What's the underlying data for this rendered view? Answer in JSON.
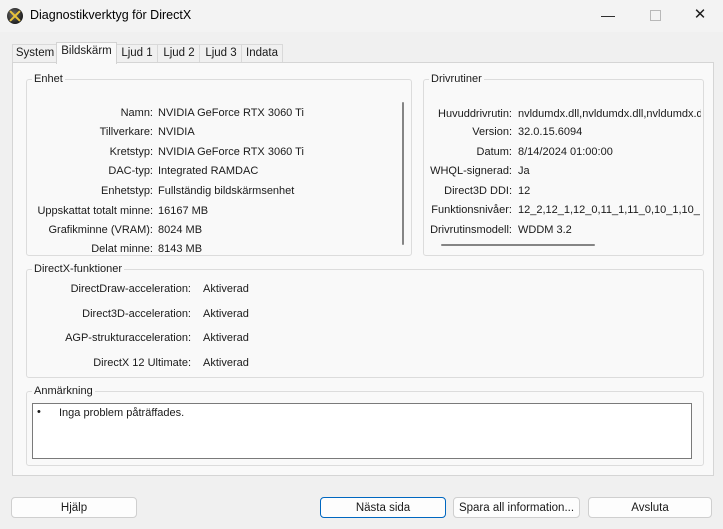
{
  "window": {
    "title": "Diagnostikverktyg för DirectX",
    "minimize_glyph": "—",
    "close_glyph": "✕"
  },
  "tabs": [
    "System",
    "Bildskärm",
    "Ljud 1",
    "Ljud 2",
    "Ljud 3",
    "Indata"
  ],
  "device": {
    "legend": "Enhet",
    "rows": [
      {
        "label": "Namn:",
        "value": "NVIDIA GeForce RTX 3060 Ti"
      },
      {
        "label": "Tillverkare:",
        "value": "NVIDIA"
      },
      {
        "label": "Kretstyp:",
        "value": "NVIDIA GeForce RTX 3060 Ti"
      },
      {
        "label": "DAC-typ:",
        "value": "Integrated RAMDAC"
      },
      {
        "label": "Enhetstyp:",
        "value": "Fullständig bildskärmsenhet"
      },
      {
        "label": "Uppskattat totalt minne:",
        "value": "16167 MB"
      },
      {
        "label": "Grafikminne (VRAM):",
        "value": "8024 MB"
      },
      {
        "label": "Delat minne:",
        "value": "8143 MB"
      }
    ]
  },
  "drivers": {
    "legend": "Drivrutiner",
    "rows": [
      {
        "label": "Huvuddrivrutin:",
        "value": "nvldumdx.dll,nvldumdx.dll,nvldumdx.d"
      },
      {
        "label": "Version:",
        "value": "32.0.15.6094"
      },
      {
        "label": "Datum:",
        "value": "8/14/2024 01:00:00"
      },
      {
        "label": "WHQL-signerad:",
        "value": "Ja"
      },
      {
        "label": "Direct3D DDI:",
        "value": "12"
      },
      {
        "label": "Funktionsnivåer:",
        "value": "12_2,12_1,12_0,11_1,11_0,10_1,10_"
      },
      {
        "label": "Drivrutinsmodell:",
        "value": "WDDM 3.2"
      }
    ]
  },
  "features": {
    "legend": "DirectX-funktioner",
    "rows": [
      {
        "label": "DirectDraw-acceleration:",
        "value": "Aktiverad"
      },
      {
        "label": "Direct3D-acceleration:",
        "value": "Aktiverad"
      },
      {
        "label": "AGP-strukturacceleration:",
        "value": "Aktiverad"
      },
      {
        "label": "DirectX 12 Ultimate:",
        "value": "Aktiverad"
      }
    ]
  },
  "notes": {
    "legend": "Anmärkning",
    "bullet": "•",
    "text": "Inga problem påträffades."
  },
  "buttons": {
    "help": "Hjälp",
    "next": "Nästa sida",
    "save": "Spara all information...",
    "exit": "Avsluta"
  }
}
